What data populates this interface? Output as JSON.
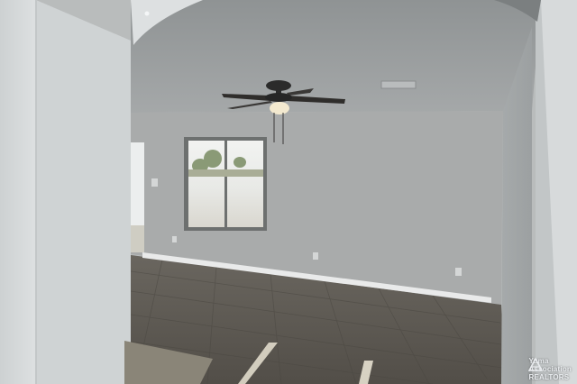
{
  "photo": {
    "subject": "empty-living-room-with-ceiling-fan",
    "colors": {
      "wall": "#a9abab",
      "ceiling": "#9a9d9e",
      "floor": "#5f5b55",
      "foreground_wall": "#cfd2d3",
      "window_light": "#e4e6e4"
    }
  },
  "watermark": {
    "line1": "Yuma",
    "line2": "Association",
    "line3": "REALTORS"
  }
}
